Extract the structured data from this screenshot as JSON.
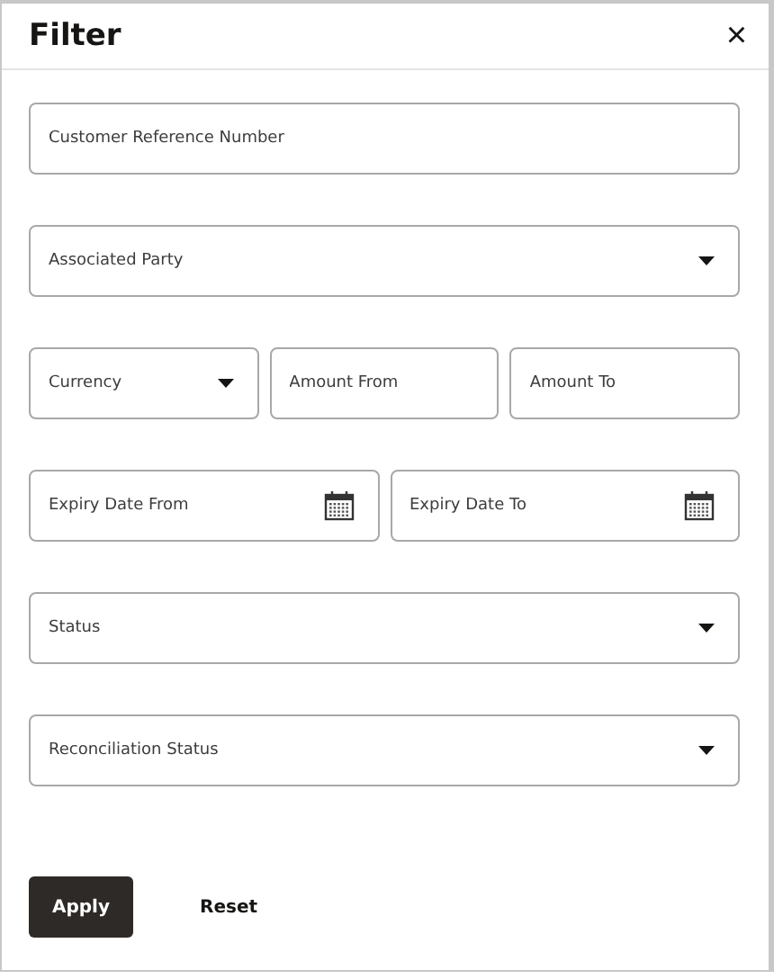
{
  "title": "Filter",
  "close": "×",
  "rows": [
    [
      {
        "kind": "text",
        "placeholder": "Customer Reference Number"
      }
    ],
    [
      {
        "kind": "select",
        "placeholder": "Associated Party"
      }
    ],
    [
      {
        "kind": "select",
        "placeholder": "Currency"
      },
      {
        "kind": "text",
        "placeholder": "Amount From"
      },
      {
        "kind": "text",
        "placeholder": "Amount To"
      }
    ],
    [
      {
        "kind": "date",
        "placeholder": "Expiry Date From"
      },
      {
        "kind": "date",
        "placeholder": "Expiry Date To"
      }
    ],
    [
      {
        "kind": "select",
        "placeholder": "Status"
      }
    ],
    [
      {
        "kind": "select",
        "placeholder": "Reconciliation Status"
      }
    ]
  ],
  "buttons": [
    {
      "kind": "primary",
      "label": "Apply"
    },
    {
      "kind": "plain",
      "label": "Reset"
    }
  ]
}
